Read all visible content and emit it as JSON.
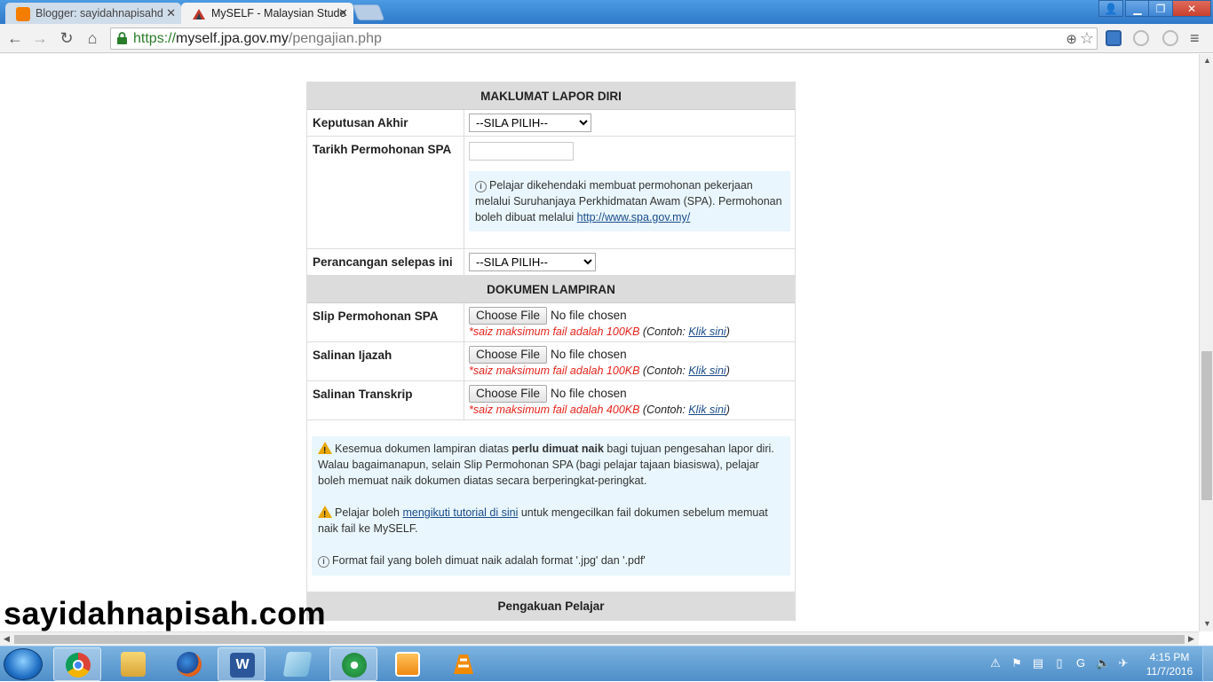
{
  "browser": {
    "tabs": [
      {
        "label": "Blogger: sayidahnapisahd",
        "active": false
      },
      {
        "label": "MySELF - Malaysian Stude",
        "active": true
      }
    ],
    "url_prefix": "https://",
    "url_host": "myself.jpa.gov.my",
    "url_path": "/pengajian.php"
  },
  "form": {
    "section1_title": "MAKLUMAT LAPOR DIRI",
    "keputusan_label": "Keputusan Akhir",
    "keputusan_value": "--SILA PILIH--",
    "tarikh_label": "Tarikh Permohonan SPA",
    "tarikh_value": "",
    "spa_info_text": "Pelajar dikehendaki membuat permohonan pekerjaan melalui Suruhanjaya Perkhidmatan Awam (SPA). Permohonan boleh dibuat melalui ",
    "spa_info_link": "http://www.spa.gov.my/",
    "perancangan_label": "Perancangan selepas ini",
    "perancangan_value": "--SILA PILIH--",
    "section2_title": "DOKUMEN LAMPIRAN",
    "files": [
      {
        "label": "Slip Permohonan SPA",
        "button": "Choose File",
        "status": "No file chosen",
        "limit": "*saiz maksimum fail adalah 100KB",
        "example_prefix": " (Contoh: ",
        "example_link": "Klik sini",
        "example_suffix": ")"
      },
      {
        "label": "Salinan Ijazah",
        "button": "Choose File",
        "status": "No file chosen",
        "limit": "*saiz maksimum fail adalah 100KB",
        "example_prefix": " (Contoh: ",
        "example_link": "Klik sini",
        "example_suffix": ")"
      },
      {
        "label": "Salinan Transkrip",
        "button": "Choose File",
        "status": "No file chosen",
        "limit": "*saiz maksimum fail adalah 400KB",
        "example_prefix": " (Contoh: ",
        "example_link": "Klik sini",
        "example_suffix": ")"
      }
    ],
    "note1_a": "Kesemua dokumen lampiran diatas ",
    "note1_bold": "perlu dimuat naik",
    "note1_b": " bagi tujuan pengesahan lapor diri. Walau bagaimanapun, selain Slip Permohonan SPA (bagi pelajar tajaan biasiswa), pelajar boleh memuat naik dokumen diatas secara berperingkat-peringkat.",
    "note2_a": "Pelajar boleh ",
    "note2_link": "mengikuti tutorial di sini",
    "note2_b": " untuk mengecilkan fail dokumen sebelum memuat naik fail ke MySELF.",
    "note3": "Format fail yang boleh dimuat naik adalah format '.jpg' dan '.pdf'",
    "section3_title": "Pengakuan Pelajar"
  },
  "watermark": "sayidahnapisah.com",
  "taskbar": {
    "time": "4:15 PM",
    "date": "11/7/2016"
  },
  "icons": {
    "back": "arrow-left-icon",
    "forward": "arrow-right-icon",
    "reload": "reload-icon",
    "home": "home-icon",
    "lock": "lock-icon",
    "zoom": "zoom-icon",
    "star": "star-icon",
    "menu": "menu-icon"
  },
  "colors": {
    "section_bg": "#dcdcdc",
    "info_bg": "#e9f6fd",
    "warning_red": "#e5231b",
    "link": "#1a4c8a",
    "url_green": "#2a7d2a"
  }
}
